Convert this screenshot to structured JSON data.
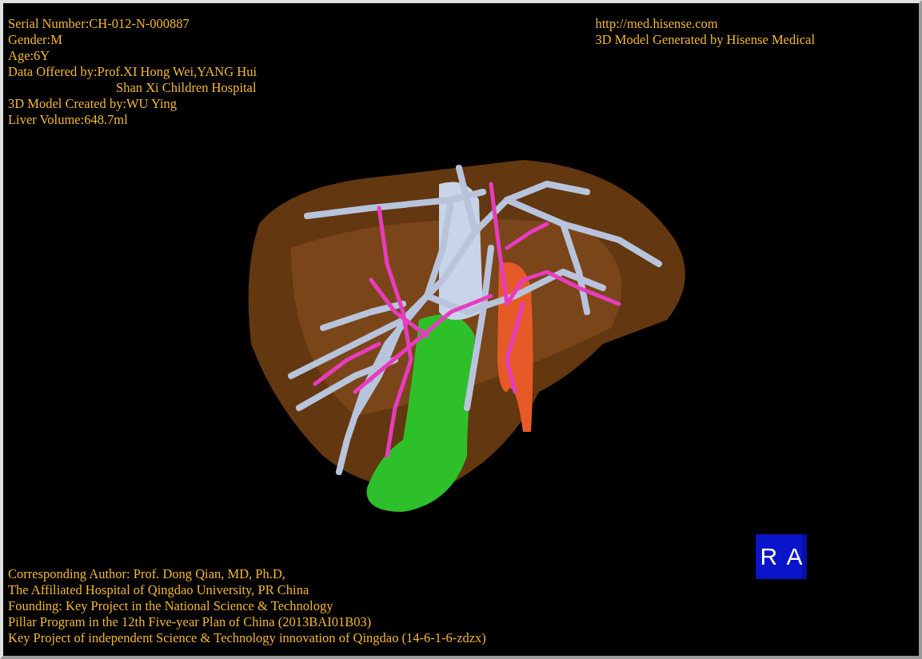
{
  "info_top_left": [
    {
      "kind": "line",
      "text": "Serial Number:CH-012-N-000887"
    },
    {
      "kind": "line",
      "text": "Gender:M"
    },
    {
      "kind": "line",
      "text": "Age:6Y"
    },
    {
      "kind": "line",
      "text": "Data Offered by:Prof.XI Hong Wei,YANG Hui"
    },
    {
      "kind": "continuation",
      "text": "Shan Xi Children Hospital"
    },
    {
      "kind": "line",
      "text": "3D Model Created by:WU Ying"
    },
    {
      "kind": "line",
      "text": "Liver Volume:648.7ml"
    }
  ],
  "info_top_right": [
    {
      "kind": "line",
      "text": "http://med.hisense.com"
    },
    {
      "kind": "line",
      "text": "3D Model Generated by Hisense Medical"
    }
  ],
  "orientation_cube": {
    "faces": [
      "R",
      "A"
    ]
  },
  "info_bottom": [
    {
      "kind": "line",
      "text": "Corresponding Author: Prof. Dong Qian, MD, Ph.D,"
    },
    {
      "kind": "line",
      "text": "The Affiliated Hospital of Qingdao University, PR China"
    },
    {
      "kind": "line",
      "text": "Founding: Key Project in the National Science & Technology"
    },
    {
      "kind": "line",
      "text": "Pillar Program in the 12th Five-year Plan of China (2013BAI01B03)"
    },
    {
      "kind": "line",
      "text": "Key Project of independent Science & Technology innovation of Qingdao (14-6-1-6-zdzx)"
    }
  ]
}
